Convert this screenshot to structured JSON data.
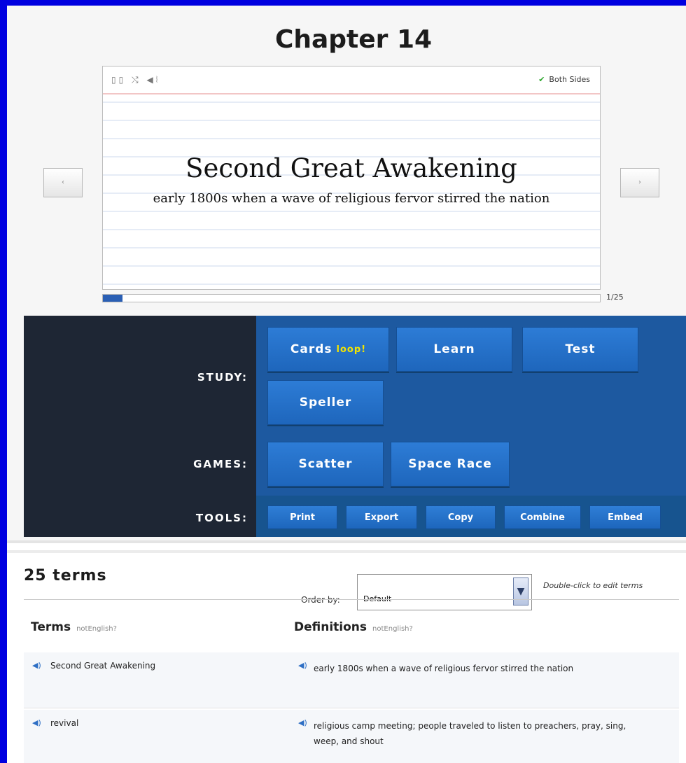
{
  "page": {
    "title": "Chapter 14"
  },
  "flashcard": {
    "term": "Second Great Awakening",
    "definition": "early 1800s when a wave of religious fervor stirred the nation",
    "both_sides_label": "Both Sides",
    "tools_icons": [
      "shuffle-grid-icon",
      "shuffle-icon",
      "speaker-mute-icon"
    ],
    "progress_count": "1/25",
    "progress_fraction": 0.04,
    "prev_label": "‹",
    "next_label": "›"
  },
  "study": {
    "study_label": "STUDY:",
    "games_label": "GAMES:",
    "tools_label": "TOOLS:",
    "modes": {
      "cards": "Cards",
      "cards_badge": "loop!",
      "learn": "Learn",
      "test": "Test",
      "speller": "Speller"
    },
    "games": {
      "scatter": "Scatter",
      "space_race": "Space Race"
    },
    "tools": {
      "print": "Print",
      "export": "Export",
      "copy": "Copy",
      "combine": "Combine",
      "embed": "Embed"
    }
  },
  "terms": {
    "count_label": "25 terms",
    "order_by_label": "Order by:",
    "order_by_value": "Default",
    "edit_hint": "Double-click to edit terms",
    "terms_header": "Terms",
    "terms_sub": "notEnglish?",
    "definitions_header": "Definitions",
    "definitions_sub": "notEnglish?",
    "rows": [
      {
        "term": "Second Great Awakening",
        "definition": "early 1800s when a wave of religious fervor stirred the nation"
      },
      {
        "term": "revival",
        "definition": "religious camp meeting; people traveled to listen to preachers, pray, sing, weep, and shout"
      }
    ]
  },
  "colors": {
    "outer_border": "#0000e0",
    "study_dark": "#1e2634",
    "study_blue": "#1d59a0",
    "button_blue": "#2d7cd6",
    "loop_yellow": "#f2e400",
    "check_green": "#2da62d"
  }
}
